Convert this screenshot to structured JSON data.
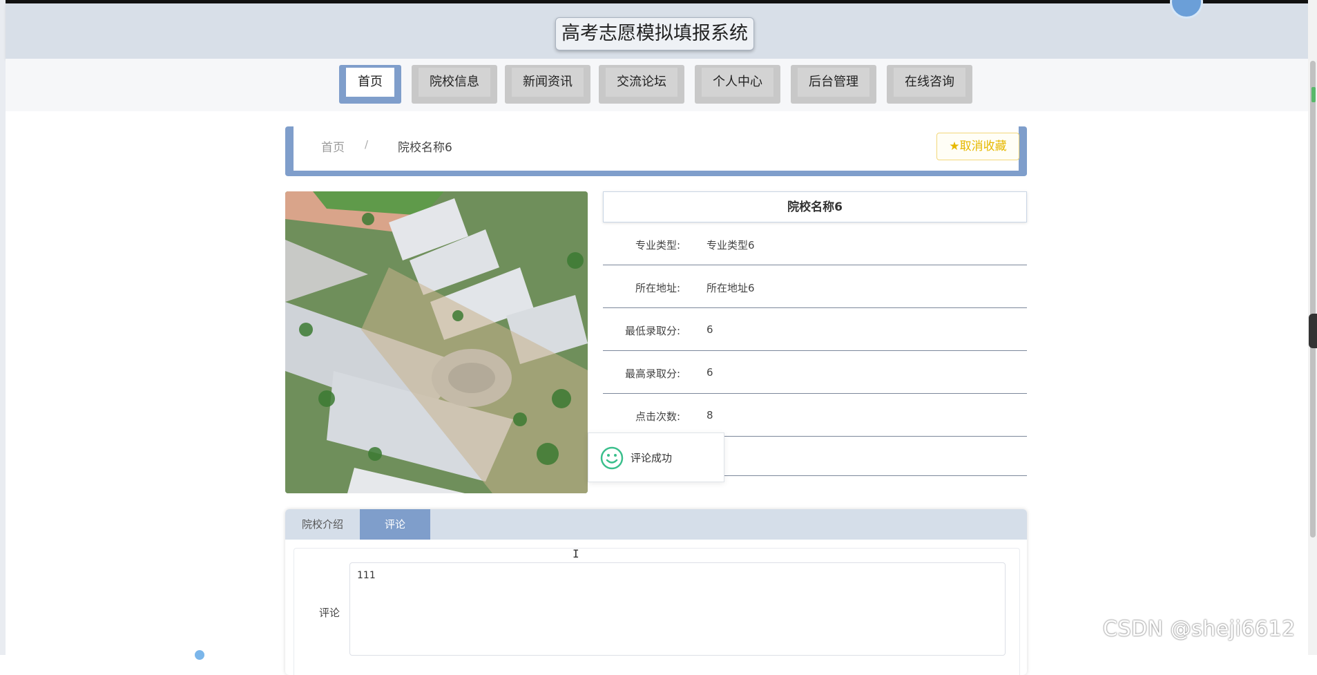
{
  "header": {
    "site_title": "高考志愿模拟填报系统"
  },
  "nav": {
    "items": [
      {
        "label": "首页",
        "active": true
      },
      {
        "label": "院校信息",
        "active": false
      },
      {
        "label": "新闻资讯",
        "active": false
      },
      {
        "label": "交流论坛",
        "active": false
      },
      {
        "label": "个人中心",
        "active": false
      },
      {
        "label": "后台管理",
        "active": false
      },
      {
        "label": "在线咨询",
        "active": false
      }
    ]
  },
  "breadcrumb": {
    "home": "首页",
    "separator": "/",
    "current": "院校名称6"
  },
  "favorite_button": {
    "icon": "star-icon",
    "label": "取消收藏",
    "color": "#e6b800"
  },
  "detail": {
    "title": "院校名称6",
    "rows": [
      {
        "label": "专业类型:",
        "value": "专业类型6"
      },
      {
        "label": "所在地址:",
        "value": "所在地址6"
      },
      {
        "label": "最低录取分:",
        "value": "6"
      },
      {
        "label": "最高录取分:",
        "value": "6"
      },
      {
        "label": "点击次数:",
        "value": "8"
      }
    ]
  },
  "toast": {
    "icon": "smile-icon",
    "message": "评论成功"
  },
  "tabs": {
    "items": [
      {
        "label": "院校介绍",
        "active": false
      },
      {
        "label": "评论",
        "active": true
      }
    ]
  },
  "comment_form": {
    "label": "评论",
    "value": "111"
  },
  "watermark": "CSDN @sheji6612",
  "colors": {
    "accent": "#7f9ecb",
    "header_bg": "#d8dfe8",
    "favorite": "#e6b800",
    "toast_icon": "#3bbf8c"
  }
}
